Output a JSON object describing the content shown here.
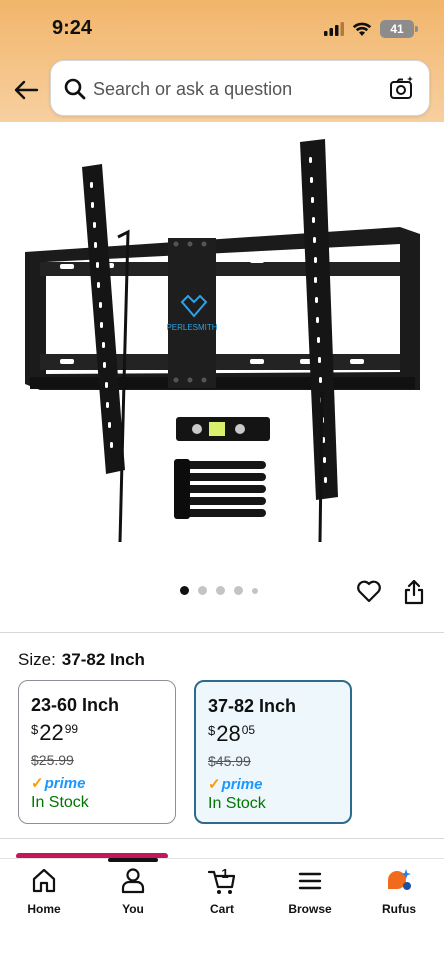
{
  "status_bar": {
    "time": "9:24",
    "battery": "41"
  },
  "search": {
    "placeholder": "Search or ask a question"
  },
  "product": {
    "brand_logo": "PERLESMITH"
  },
  "carousel": {
    "dots": 5,
    "active": 0
  },
  "size": {
    "label": "Size:",
    "selected": "37-82 Inch"
  },
  "size_options": [
    {
      "title": "23-60 Inch",
      "currency": "$",
      "price_whole": "22",
      "price_fraction": "99",
      "list_price": "$25.99",
      "prime": "prime",
      "stock": "In Stock",
      "selected": false
    },
    {
      "title": "37-82 Inch",
      "currency": "$",
      "price_whole": "28",
      "price_fraction": "05",
      "list_price": "$45.99",
      "prime": "prime",
      "stock": "In Stock",
      "selected": true
    }
  ],
  "bottom_nav": {
    "items": [
      {
        "label": "Home",
        "icon": "home-icon"
      },
      {
        "label": "You",
        "icon": "person-icon"
      },
      {
        "label": "Cart",
        "icon": "cart-icon",
        "badge": "1"
      },
      {
        "label": "Browse",
        "icon": "menu-icon"
      },
      {
        "label": "Rufus",
        "icon": "rufus-icon"
      }
    ]
  },
  "colors": {
    "header": "#f3bb78",
    "selected_border": "#2f6a8a",
    "stock_green": "#007600",
    "prime_blue": "#1a98ff",
    "accent": "#c2185b"
  }
}
